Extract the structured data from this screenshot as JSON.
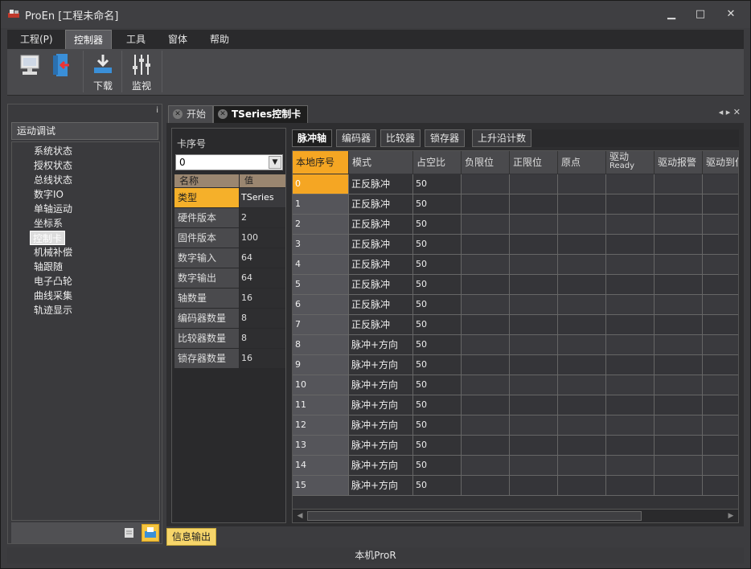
{
  "window": {
    "title": "ProEn [工程未命名]",
    "minimize": "▁",
    "maximize": "□",
    "close": "✕"
  },
  "menu": [
    "工程(P)",
    "控制器",
    "工具",
    "窗体",
    "帮助"
  ],
  "ribbon": {
    "download_label": "下载",
    "monitor_label": "监视"
  },
  "left_panel": {
    "header": "运动调试",
    "pin": "ⅰ",
    "items": [
      "系统状态",
      "授权状态",
      "总线状态",
      "数字IO",
      "单轴运动",
      "坐标系",
      "控制卡",
      "机械补偿",
      "轴跟随",
      "电子凸轮",
      "曲线采集",
      "轨迹显示"
    ],
    "selected_index": 6
  },
  "doc_tabs": [
    {
      "label": "开始",
      "active": false
    },
    {
      "label": "TSeries控制卡",
      "active": true
    }
  ],
  "card": {
    "label": "卡序号",
    "selected": "0",
    "props_header": {
      "name": "名称",
      "value": "值"
    },
    "props": [
      {
        "name": "类型",
        "value": "TSeries"
      },
      {
        "name": "硬件版本",
        "value": "2"
      },
      {
        "name": "固件版本",
        "value": "100"
      },
      {
        "name": "数字输入",
        "value": "64"
      },
      {
        "name": "数字输出",
        "value": "64"
      },
      {
        "name": "轴数量",
        "value": "16"
      },
      {
        "name": "编码器数量",
        "value": "8"
      },
      {
        "name": "比较器数量",
        "value": "8"
      },
      {
        "name": "锁存器数量",
        "value": "16"
      }
    ]
  },
  "sub_tabs": [
    "脉冲轴",
    "编码器",
    "比较器",
    "锁存器",
    "上升沿计数"
  ],
  "grid": {
    "columns": [
      "本地序号",
      "模式",
      "占空比",
      "负限位",
      "正限位",
      "原点",
      "驱动Ready",
      "驱动报警",
      "驱动到位"
    ],
    "column_line2": {
      "6": "Ready"
    },
    "column_line1": {
      "6": "驱动"
    },
    "rows": [
      [
        "0",
        "正反脉冲",
        "50"
      ],
      [
        "1",
        "正反脉冲",
        "50"
      ],
      [
        "2",
        "正反脉冲",
        "50"
      ],
      [
        "3",
        "正反脉冲",
        "50"
      ],
      [
        "4",
        "正反脉冲",
        "50"
      ],
      [
        "5",
        "正反脉冲",
        "50"
      ],
      [
        "6",
        "正反脉冲",
        "50"
      ],
      [
        "7",
        "正反脉冲",
        "50"
      ],
      [
        "8",
        "脉冲+方向",
        "50"
      ],
      [
        "9",
        "脉冲+方向",
        "50"
      ],
      [
        "10",
        "脉冲+方向",
        "50"
      ],
      [
        "11",
        "脉冲+方向",
        "50"
      ],
      [
        "12",
        "脉冲+方向",
        "50"
      ],
      [
        "13",
        "脉冲+方向",
        "50"
      ],
      [
        "14",
        "脉冲+方向",
        "50"
      ],
      [
        "15",
        "脉冲+方向",
        "50"
      ]
    ]
  },
  "bottom_tab": "信息输出",
  "status": "本机ProR",
  "colors": {
    "accent": "#f5a623",
    "selected_cell": "#f5a623"
  }
}
